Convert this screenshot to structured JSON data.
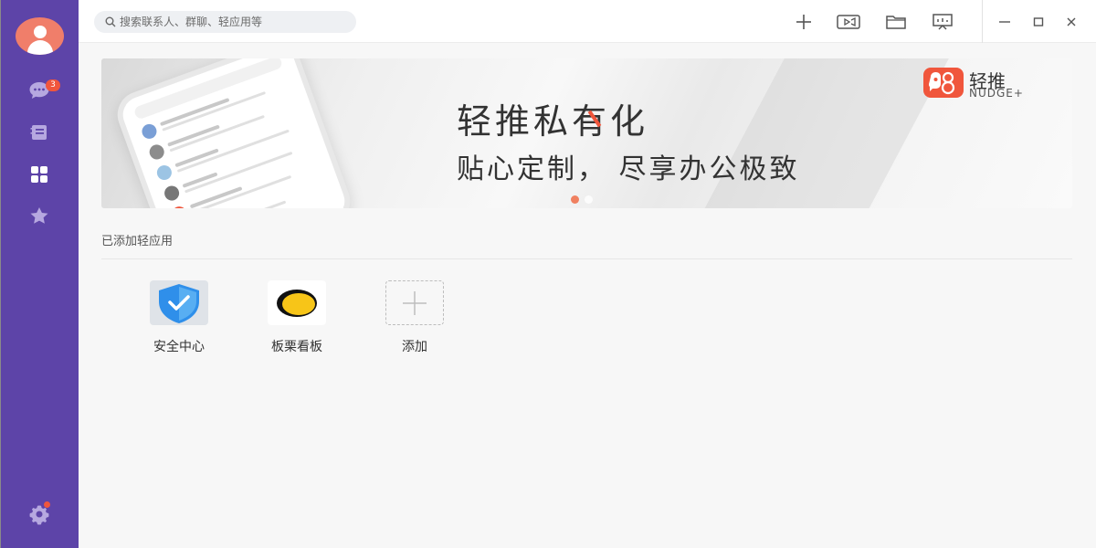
{
  "sidebar": {
    "badges": {
      "messages": "3"
    },
    "items": [
      {
        "name": "messages",
        "icon": "chat-bubble-icon"
      },
      {
        "name": "contacts",
        "icon": "address-book-icon"
      },
      {
        "name": "apps",
        "icon": "grid-apps-icon",
        "active": true
      },
      {
        "name": "favorites",
        "icon": "star-icon"
      }
    ],
    "settings_icon": "gear-icon"
  },
  "topbar": {
    "search_placeholder": "搜索联系人、群聊、轻应用等",
    "actions": [
      "plus-icon",
      "video-call-icon",
      "folder-icon",
      "presentation-icon"
    ],
    "window_controls": [
      "minimize-icon",
      "maximize-icon",
      "close-icon"
    ]
  },
  "banner": {
    "title": "轻推私有化",
    "subtitle": "贴心定制， 尽享办公极致",
    "logo_cn": "轻推",
    "logo_en": "NUDGE+",
    "slide_count": 2,
    "active_slide": 1,
    "accent_color": "#f0563c"
  },
  "section": {
    "title": "已添加轻应用"
  },
  "apps": [
    {
      "label": "安全中心",
      "icon": "shield-check-icon"
    },
    {
      "label": "板栗看板",
      "icon": "chestnut-board-icon"
    },
    {
      "label": "添加",
      "icon": "plus-icon"
    }
  ],
  "colors": {
    "sidebar": "#5d44a8",
    "accent": "#f0563c",
    "avatar": "#f07e6a"
  }
}
